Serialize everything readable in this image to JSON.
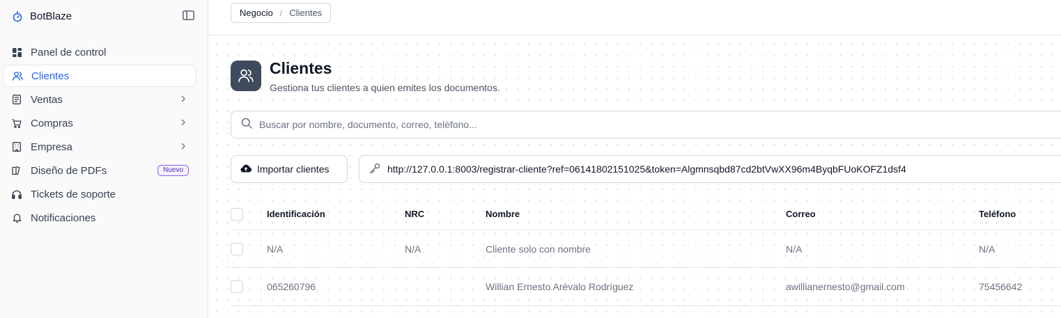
{
  "app": {
    "name": "BotBlaze"
  },
  "sidebar": {
    "items": [
      {
        "label": "Panel de control",
        "icon": "dashboard-icon"
      },
      {
        "label": "Clientes",
        "icon": "users-icon",
        "active": true
      },
      {
        "label": "Ventas",
        "icon": "receipt-icon",
        "has_submenu": true
      },
      {
        "label": "Compras",
        "icon": "cart-icon",
        "has_submenu": true
      },
      {
        "label": "Empresa",
        "icon": "building-icon",
        "has_submenu": true
      },
      {
        "label": "Diseño de PDFs",
        "icon": "documents-icon",
        "badge": "Nuevo"
      },
      {
        "label": "Tickets de soporte",
        "icon": "headphones-icon"
      },
      {
        "label": "Notificaciones",
        "icon": "bell-icon"
      }
    ]
  },
  "breadcrumb": {
    "items": [
      "Negocio",
      "Clientes"
    ],
    "separator": "/"
  },
  "page": {
    "title": "Clientes",
    "subtitle": "Gestiona tus clientes a quien emites los documentos."
  },
  "search": {
    "placeholder": "Buscar por nombre, documento, correo, teléfono...",
    "value": ""
  },
  "actions": {
    "import_label": "Importar clientes",
    "registration_link": "http://127.0.0.1:8003/registrar-cliente?ref=06141802151025&token=Algmnsqbd87cd2btVwXX96m4ByqbFUoKOFZ1dsf4"
  },
  "table": {
    "columns": [
      "Identificación",
      "NRC",
      "Nombre",
      "Correo",
      "Teléfono"
    ],
    "rows": [
      [
        "N/A",
        "N/A",
        "Cliente solo con nombre",
        "N/A",
        "N/A"
      ],
      [
        "065260796",
        "",
        "Willian Ernesto Arévalo Rodríguez",
        "awillianernesto@gmail.com",
        "75456642"
      ]
    ]
  },
  "colors": {
    "accent": "#2563eb",
    "badge": "#8b5cf6",
    "page_icon_bg": "#3f4a5c",
    "sidebar_bg": "#fafafa"
  }
}
